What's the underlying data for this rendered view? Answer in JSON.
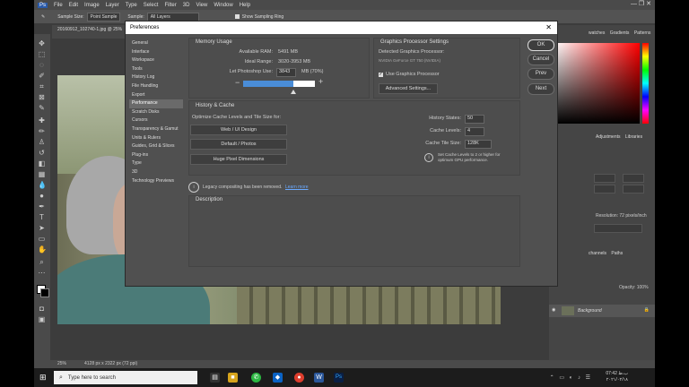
{
  "menu": [
    "File",
    "Edit",
    "Image",
    "Layer",
    "Type",
    "Select",
    "Filter",
    "3D",
    "View",
    "Window",
    "Help"
  ],
  "options_bar": {
    "sample_size_label": "Sample Size:",
    "sample_size_value": "Point Sample",
    "sample_label": "Sample:",
    "sample_value": "All Layers",
    "show_ring_label": "Show Sampling Ring"
  },
  "doc_tab": "20160912_102740-1.jpg @ 25%",
  "right_panel": {
    "tabs_top": [
      "watches",
      "Gradients",
      "Patterns"
    ],
    "tabs_mid": [
      "Adjustments",
      "Libraries"
    ],
    "resolution": "Resolution: 72 pixels/inch",
    "tabs_bottom": [
      "channels",
      "Paths"
    ],
    "opacity_label": "Opacity: 100%",
    "layer_name": "Background"
  },
  "status_bar": {
    "zoom": "25%",
    "size": "4128 px x 2322 px (72 ppi)"
  },
  "taskbar": {
    "search_placeholder": "Type here to search",
    "time": "07:42 ب.ظ",
    "date": "۲۰۲۱/۰۲/۱۸"
  },
  "dialog": {
    "title": "Preferences",
    "nav": [
      "General",
      "Interface",
      "Workspace",
      "Tools",
      "History Log",
      "File Handling",
      "Export",
      "Performance",
      "Scratch Disks",
      "Cursors",
      "Transparency & Gamut",
      "Units & Rulers",
      "Guides, Grid & Slices",
      "Plug-ins",
      "Type",
      "3D",
      "Technology Previews"
    ],
    "nav_active_index": 7,
    "memory": {
      "title": "Memory Usage",
      "available_label": "Available RAM:",
      "available_value": "5491 MB",
      "ideal_label": "Ideal Range:",
      "ideal_value": "3020-3953 MB",
      "use_label": "Let Photoshop Use:",
      "use_value": "3843",
      "use_suffix": "MB (70%)",
      "percent": 70,
      "minus": "−",
      "plus": "+"
    },
    "gpu": {
      "title": "Graphics Processor Settings",
      "detected_label": "Detected Graphics Processor:",
      "detected_value": "NVIDIA GeForce GT 750 (NVIDIA)",
      "use_label": "Use Graphics Processor",
      "use_checked": true,
      "advanced_button": "Advanced Settings..."
    },
    "history_cache": {
      "title": "History & Cache",
      "optimize_label": "Optimize Cache Levels and Tile Size for:",
      "buttons": [
        "Web / UI Design",
        "Default / Photos",
        "Huge Pixel Dimensions"
      ],
      "history_states_label": "History States:",
      "history_states_value": "50",
      "cache_levels_label": "Cache Levels:",
      "cache_levels_value": "4",
      "cache_tile_label": "Cache Tile Size:",
      "cache_tile_value": "128K",
      "note": "Set Cache Levels to 2 or higher for optimum GPU performance."
    },
    "legacy": {
      "text": "Legacy compositing has been removed.",
      "link": "Learn more"
    },
    "description_title": "Description",
    "side_buttons": [
      "OK",
      "Cancel",
      "Prev",
      "Next"
    ]
  },
  "colors": {
    "accent": "#4a8dd8",
    "dialog_bg": "#505050"
  }
}
